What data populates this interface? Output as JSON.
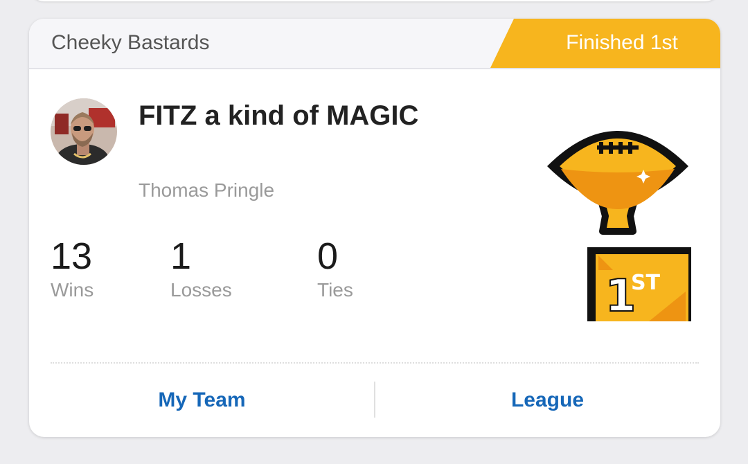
{
  "card": {
    "league_name": "Cheeky Bastards",
    "finish_label": "Finished 1st",
    "team_name": "FITZ a kind of MAGIC",
    "owner_name": "Thomas Pringle",
    "stats": [
      {
        "value": "13",
        "label": "Wins"
      },
      {
        "value": "1",
        "label": "Losses"
      },
      {
        "value": "0",
        "label": "Ties"
      }
    ],
    "trophy": {
      "icon": "first-place-trophy-icon",
      "place_text": "1",
      "place_suffix": "ST"
    },
    "actions": {
      "my_team_label": "My Team",
      "league_label": "League"
    }
  },
  "colors": {
    "accent_gold": "#f7b51e",
    "link_blue": "#1667b8",
    "header_bg": "#f6f6f9"
  }
}
